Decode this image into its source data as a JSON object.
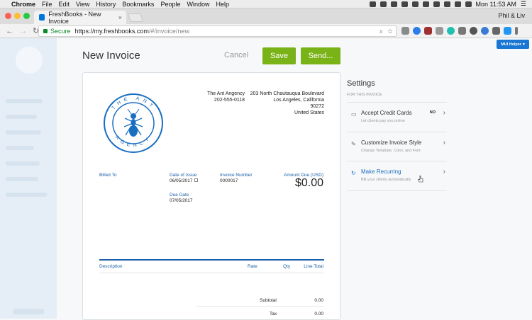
{
  "menubar": {
    "apple_glyph": "",
    "app": "Chrome",
    "items": [
      "File",
      "Edit",
      "View",
      "History",
      "Bookmarks",
      "People",
      "Window",
      "Help"
    ],
    "clock": "Mon 11:53 AM"
  },
  "browser": {
    "tab_title": "FreshBooks - New Invoice",
    "tab_close": "×",
    "profile": "Phil & Liv",
    "secure_label": "Secure",
    "url_base": "https://my.freshbooks.com",
    "url_path": "/#/invoice/new",
    "back": "←",
    "forward": "→",
    "reload": "↻"
  },
  "page": {
    "title": "New Invoice",
    "cancel_label": "Cancel",
    "save_label": "Save",
    "send_label": "Send...",
    "mui_helper": "MUI Helper",
    "colors": {
      "primary_green": "#7ab317",
      "link_blue": "#1a5fa7",
      "mui_blue": "#1976d2"
    }
  },
  "invoice": {
    "company_name": "The Ant Angency",
    "company_phone": "202-555-0118",
    "address_line1": "203 North Chautauqua Boulevard",
    "address_line2": "Los Angeles, California",
    "address_line3": "90272",
    "address_line4": "United States",
    "logo_letters_top": "THE ANT",
    "logo_letters_bottom": "AGENCY",
    "billed_to_label": "Billed To",
    "date_of_issue_label": "Date of Issue",
    "date_of_issue": "06/05/2017",
    "due_date_label": "Due Date",
    "due_date": "07/05/2017",
    "invoice_number_label": "Invoice Number",
    "invoice_number": "0000017",
    "amount_due_label": "Amount Due (USD)",
    "amount_due": "$0.00",
    "columns": [
      "Description",
      "Rate",
      "Qty",
      "Line Total"
    ],
    "subtotal_label": "Subtotal",
    "subtotal": "0.00",
    "tax_label": "Tax",
    "tax": "0.00"
  },
  "settings": {
    "title": "Settings",
    "subtitle": "FOR THIS INVOICE",
    "items": [
      {
        "title": "Accept Credit Cards",
        "desc": "Let clients pay you online",
        "badge": "NO",
        "icon": "credit-card-icon"
      },
      {
        "title": "Customize Invoice Style",
        "desc": "Change Template, Color, and Font",
        "icon": "brush-icon"
      },
      {
        "title": "Make Recurring",
        "desc": "Bill your clients automatically",
        "icon": "recurring-icon"
      }
    ],
    "chevron": "›"
  }
}
